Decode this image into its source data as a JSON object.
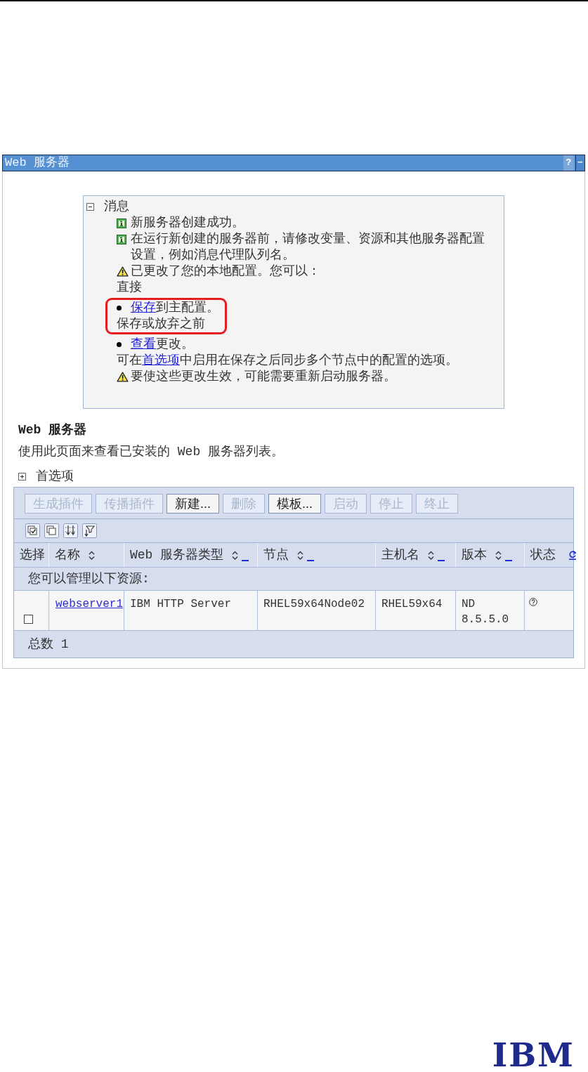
{
  "window": {
    "title": "Web 服务器",
    "help_button": "?",
    "minimize_button": "−"
  },
  "messages": {
    "title": "消息",
    "expanded": true,
    "lines": [
      {
        "kind": "info",
        "segments": [
          {
            "text": "新服务器创建成功。"
          }
        ]
      },
      {
        "kind": "info",
        "segments": [
          {
            "text": "在运行新创建的服务器前，请修改变量、资源和其他服务器配置设置，例如消息代理队列名。"
          }
        ]
      },
      {
        "kind": "warning",
        "segments": [
          {
            "text": "已更改了您的本地配置。您可以："
          }
        ]
      },
      {
        "kind": "plain",
        "segments": [
          {
            "text": "直接"
          }
        ]
      },
      {
        "kind": "framed",
        "lines": [
          {
            "kind": "bullet",
            "segments": [
              {
                "text": "保存",
                "link": true
              },
              {
                "text": "到主配置。"
              }
            ]
          },
          {
            "kind": "plain",
            "segments": [
              {
                "text": "保存或放弃之前"
              }
            ]
          }
        ]
      },
      {
        "kind": "bullet",
        "segments": [
          {
            "text": "查看",
            "link": true
          },
          {
            "text": "更改。"
          }
        ]
      },
      {
        "kind": "plain",
        "segments": [
          {
            "text": "可在"
          },
          {
            "text": "首选项",
            "link": true
          },
          {
            "text": "中启用在保存之后同步多个节点中的配置的选项。"
          }
        ]
      },
      {
        "kind": "warning",
        "segments": [
          {
            "text": "要使这些更改生效，可能需要重新启动服务器。"
          }
        ]
      }
    ]
  },
  "section": {
    "title": "Web 服务器",
    "description": "使用此页面来查看已安装的 Web 服务器列表。"
  },
  "preferences": {
    "label": "首选项",
    "expanded": false
  },
  "table": {
    "buttons": [
      {
        "label": "生成插件",
        "disabled": true
      },
      {
        "label": "传播插件",
        "disabled": true
      },
      {
        "label": "新建...",
        "disabled": false
      },
      {
        "label": "删除",
        "disabled": true
      },
      {
        "label": "模板...",
        "disabled": false
      },
      {
        "label": "启动",
        "disabled": true
      },
      {
        "label": "停止",
        "disabled": true
      },
      {
        "label": "终止",
        "disabled": true
      }
    ],
    "columns": [
      {
        "label": "选择"
      },
      {
        "label": "名称",
        "sort": true
      },
      {
        "label": "Web 服务器类型",
        "sort": true,
        "filter": true
      },
      {
        "label": "节点",
        "sort": true,
        "filter": true
      },
      {
        "label": "主机名",
        "sort": true,
        "filter": true
      },
      {
        "label": "版本",
        "sort": true,
        "filter": true
      },
      {
        "label": "状态",
        "refresh": true
      }
    ],
    "group_label": "您可以管理以下资源:",
    "rows": [
      {
        "selected": false,
        "cells": [
          {
            "kind": "checkbox"
          },
          {
            "kind": "link",
            "text": "webserver1"
          },
          {
            "kind": "text",
            "text": "IBM HTTP Server"
          },
          {
            "kind": "text",
            "text": "RHEL59x64Node02"
          },
          {
            "kind": "text",
            "text": "RHEL59x64"
          },
          {
            "kind": "text",
            "text": "ND 8.5.5.0"
          },
          {
            "kind": "status"
          }
        ]
      }
    ],
    "total": "总数 1"
  },
  "footer": {
    "logo": "IBM"
  }
}
